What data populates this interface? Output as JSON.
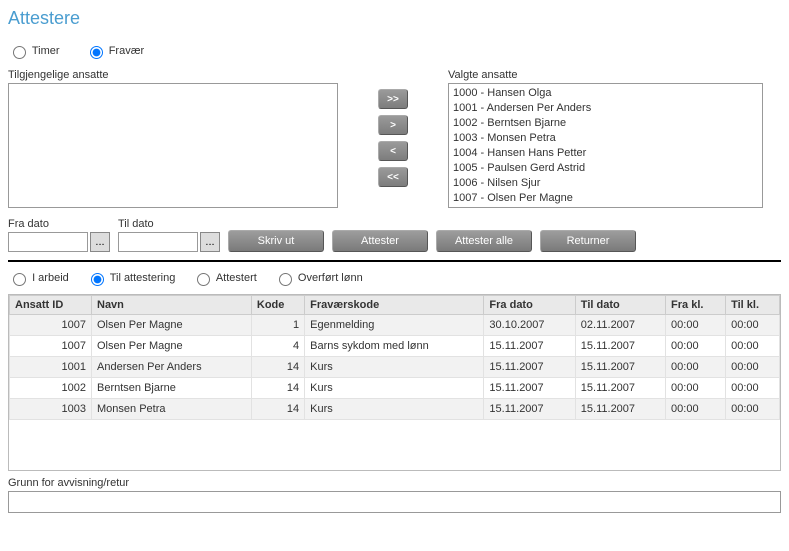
{
  "title": "Attestere",
  "modeRadios": {
    "timer": "Timer",
    "fravaer": "Fravær"
  },
  "lists": {
    "availableLabel": "Tilgjengelige ansatte",
    "selectedLabel": "Valgte ansatte",
    "available": [],
    "selected": [
      "1000 - Hansen Olga",
      "1001 - Andersen Per Anders",
      "1002 - Berntsen Bjarne",
      "1003 - Monsen Petra",
      "1004 - Hansen Hans Petter",
      "1005 - Paulsen Gerd Astrid",
      "1006 - Nilsen Sjur",
      "1007 - Olsen Per Magne"
    ]
  },
  "moveBtns": {
    "all_r": ">>",
    "one_r": ">",
    "one_l": "<",
    "all_l": "<<"
  },
  "dates": {
    "fromLabel": "Fra dato",
    "toLabel": "Til dato",
    "pickGlyph": "..."
  },
  "actions": {
    "print": "Skriv ut",
    "attest": "Attester",
    "attestAll": "Attester alle",
    "return": "Returner"
  },
  "statusRadios": {
    "working": "I arbeid",
    "toAttest": "Til attestering",
    "attested": "Attestert",
    "transferred": "Overført lønn"
  },
  "grid": {
    "columns": [
      "Ansatt ID",
      "Navn",
      "Kode",
      "Fraværskode",
      "Fra dato",
      "Til dato",
      "Fra kl.",
      "Til kl."
    ],
    "rows": [
      {
        "id": "1007",
        "navn": "Olsen Per Magne",
        "kode": "1",
        "fkode": "Egenmelding",
        "fra": "30.10.2007",
        "til": "02.11.2007",
        "frakl": "00:00",
        "tilkl": "00:00"
      },
      {
        "id": "1007",
        "navn": "Olsen Per Magne",
        "kode": "4",
        "fkode": "Barns sykdom med lønn",
        "fra": "15.11.2007",
        "til": "15.11.2007",
        "frakl": "00:00",
        "tilkl": "00:00"
      },
      {
        "id": "1001",
        "navn": "Andersen Per Anders",
        "kode": "14",
        "fkode": "Kurs",
        "fra": "15.11.2007",
        "til": "15.11.2007",
        "frakl": "00:00",
        "tilkl": "00:00"
      },
      {
        "id": "1002",
        "navn": "Berntsen Bjarne",
        "kode": "14",
        "fkode": "Kurs",
        "fra": "15.11.2007",
        "til": "15.11.2007",
        "frakl": "00:00",
        "tilkl": "00:00"
      },
      {
        "id": "1003",
        "navn": "Monsen Petra",
        "kode": "14",
        "fkode": "Kurs",
        "fra": "15.11.2007",
        "til": "15.11.2007",
        "frakl": "00:00",
        "tilkl": "00:00"
      }
    ]
  },
  "reason": {
    "label": "Grunn for avvisning/retur",
    "value": ""
  }
}
